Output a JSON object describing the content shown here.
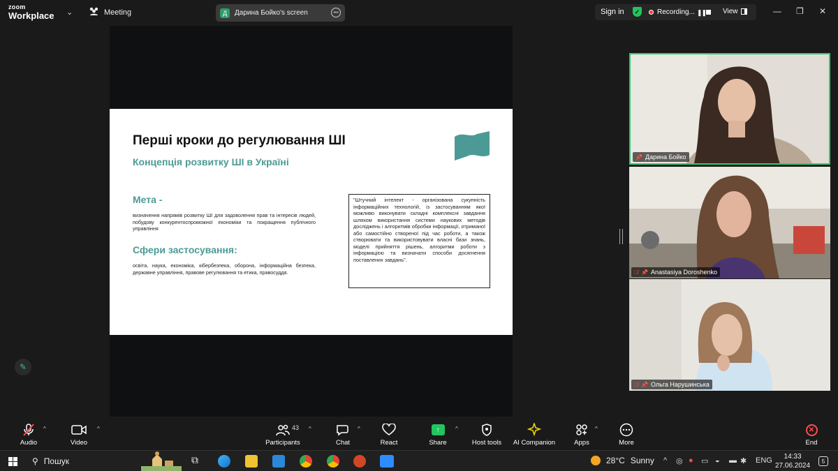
{
  "app": {
    "brand_small": "zoom",
    "brand_big": "Workplace",
    "meeting_label": "Meeting"
  },
  "share_pill": {
    "avatar_letter": "Д",
    "label": "Дарина Бойко's screen"
  },
  "top_right": {
    "sign_in": "Sign in",
    "recording": "Recording...",
    "view": "View"
  },
  "slide": {
    "title": "Перші кроки до регулювання ШІ",
    "subtitle": "Концепція розвитку ШІ в Україні",
    "goal_heading": "Мета -",
    "goal_text": "визначення напрямів розвитку ШІ для задоволення прав та інтересів людей, побудову конкурентоспроможної економіки та покращення публічного управління",
    "spheres_heading": "Сфери застосування:",
    "spheres_text": "освіта, наука, економіка, кібербезпека, оборона, інформаційна безпека, державне управління, правове регулювання та етика, правосуддя.",
    "quote": "\"Штучний інтелект - організована сукупність інформаційних технологій, із застосуванням якої можливо виконувати складні комплексні завдання шляхом використання системи наукових методів досліджень і алгоритмів обробки інформації, отриманої або самостійно створеної під час роботи, а також створювати та використовувати власні бази знань, моделі прийняття рішень, алгоритми роботи з інформацією та визначати способи досягнення поставлених завдань\"."
  },
  "participants": [
    {
      "name": "Дарина Бойко",
      "muted": false
    },
    {
      "name": "Anastasiya Doroshenko",
      "muted": true
    },
    {
      "name": "Ольга Нарушинська",
      "muted": true
    }
  ],
  "toolbar": {
    "audio": "Audio",
    "video": "Video",
    "participants": "Participants",
    "participants_count": "43",
    "chat": "Chat",
    "react": "React",
    "share": "Share",
    "host_tools": "Host tools",
    "ai_companion": "AI Companion",
    "apps": "Apps",
    "more": "More",
    "end": "End"
  },
  "taskbar": {
    "search": "Пошук",
    "temperature": "28°C",
    "weather": "Sunny",
    "language": "ENG",
    "time": "14:33",
    "date": "27.06.2024",
    "notifications": "5"
  },
  "colors": {
    "accent_teal": "#4c9a95",
    "speaker_border": "#2ecc71",
    "share_green": "#22c55e",
    "end_red": "#ff4d4d"
  }
}
